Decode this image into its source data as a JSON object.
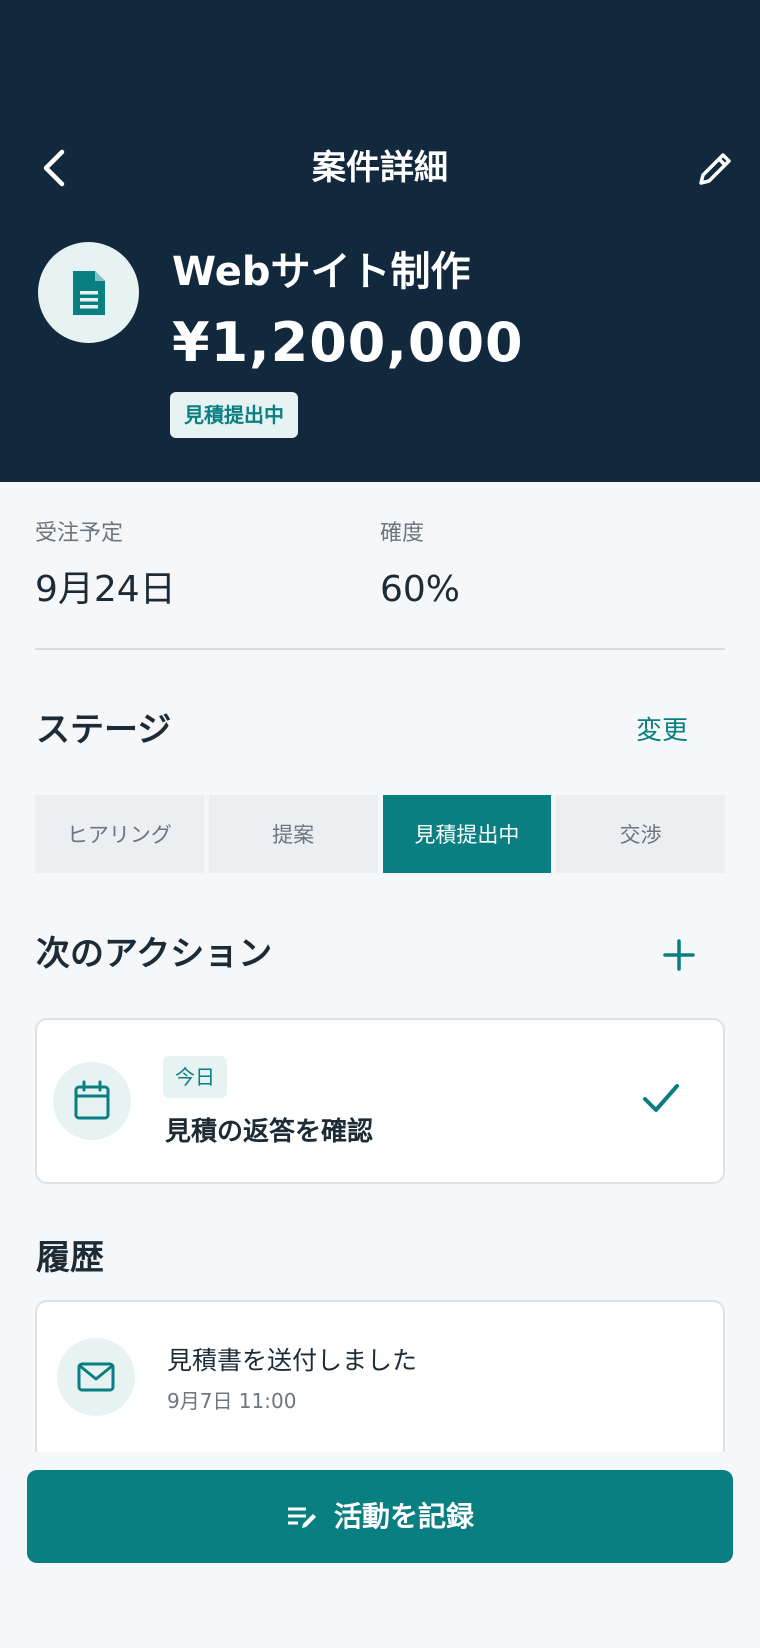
{
  "nav": {
    "title": "案件詳細"
  },
  "deal": {
    "name": "Webサイト制作",
    "amount": "¥1,200,000",
    "status": "見積提出中"
  },
  "meta": {
    "expected_label": "受注予定",
    "expected_value": "9月24日",
    "probability_label": "確度",
    "probability_value": "60%"
  },
  "stage_section": {
    "title": "ステージ",
    "change_label": "変更",
    "stages": [
      {
        "label": "ヒアリング"
      },
      {
        "label": "提案"
      },
      {
        "label": "見積提出中"
      },
      {
        "label": "交渉"
      }
    ],
    "current": "見積提出中"
  },
  "next_actions": {
    "title": "次のアクション",
    "items": [
      {
        "badge": "今日",
        "title": "見積の返答を確認"
      }
    ]
  },
  "history": {
    "title": "履歴",
    "items": [
      {
        "title": "見積書を送付しました",
        "time": "9月7日 11:00"
      }
    ]
  },
  "footer": {
    "record_label": "活動を記録"
  },
  "colors": {
    "header_bg": "#11283d",
    "accent": "#0a7f82",
    "background": "#f5f7f9"
  },
  "icons": {
    "back": "chevron-left-icon",
    "edit": "pencil-icon",
    "deal": "document-icon",
    "add": "plus-icon",
    "action": "calendar-icon",
    "done": "check-icon",
    "history": "mail-icon",
    "record": "note-edit-icon"
  }
}
